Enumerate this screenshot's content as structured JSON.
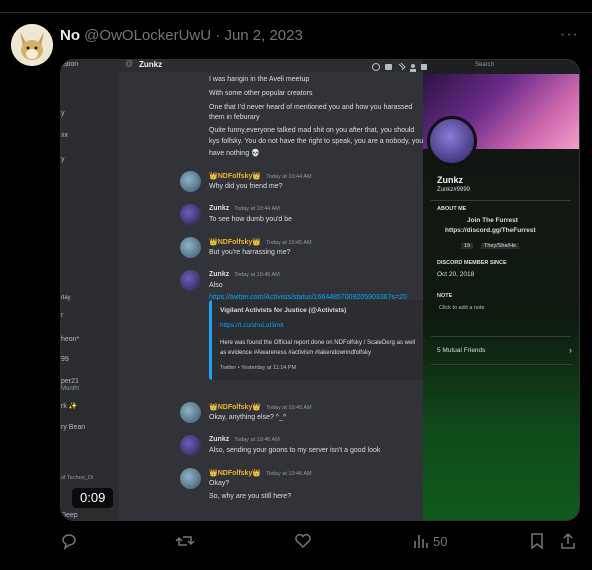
{
  "tweet": {
    "display_name": "No",
    "handle": "@OwOLockerUwU",
    "separator": "·",
    "date": "Jun 2, 2023",
    "more": "···",
    "views": "50"
  },
  "video": {
    "timer": "0:09"
  },
  "discord": {
    "channel": "Zunkz",
    "search_placeholder": "Search",
    "left_partial": [
      "ation",
      "y",
      "xx",
      "y",
      "day",
      "r",
      "heon*",
      "99",
      "per21",
      "Month!",
      "rk ✨",
      "ry Bean",
      "of Techno_Oi",
      "Deep"
    ],
    "messages": [
      {
        "type": "text",
        "text": "I was hangin in the Aveli meetup"
      },
      {
        "type": "text",
        "text": "With some other popular creators"
      },
      {
        "type": "text",
        "text": "One that I'd never heard of mentioned you and how you harassed"
      },
      {
        "type": "text",
        "text": "them in feburary"
      },
      {
        "type": "text",
        "text": "Quite funny,everyone talked mad shit on you after that, you should"
      },
      {
        "type": "text",
        "text": "kys folfsky. You do not have the right to speak, you are a nobody, you"
      },
      {
        "type": "text",
        "text": "have nothing 💀"
      }
    ],
    "posts": [
      {
        "user": "👑NDFolfsky👑",
        "time": "Today at 10:44 AM",
        "text": "Why did you friend me?",
        "color": "#f0b232"
      },
      {
        "user": "Zunkz",
        "time": "Today at 10:44 AM",
        "text": "To see how dumb you'd be",
        "color": "#dbdee1"
      },
      {
        "user": "👑NDFolfsky👑",
        "time": "Today at 10:45 AM",
        "text": "But you're harrassing me?",
        "color": "#f0b232"
      },
      {
        "user": "Zunkz",
        "time": "Today at 10:45 AM",
        "text": "Also",
        "color": "#dbdee1"
      },
      {
        "user": "👑NDFolfsky👑",
        "time": "Today at 10:45 AM",
        "text": "Okay, anything else? ^_^",
        "color": "#f0b232"
      },
      {
        "user": "Zunkz",
        "time": "Today at 10:46 AM",
        "text": "Also, sending your goons to my server isn't a good look",
        "color": "#dbdee1"
      },
      {
        "user": "👑NDFolfsky👑",
        "time": "Today at 10:46 AM",
        "text": "Okay?",
        "color": "#f0b232"
      }
    ],
    "last_line": "So, why are you still here?",
    "link": "https://twitter.com/Activists/status/1664485700920590336?s=20",
    "embed": {
      "title": "Vigilant Activists for Justice (@Activists)",
      "short": "https://t.co/shoLoI3mll",
      "body1": "Here was found the Official report done on NDFolfsky / ScaleDerg as well",
      "body2": "as evidence #Awareness #activism #takendownndfolfsky",
      "footer": "Twitter • Yesterday at 11:14 PM"
    },
    "profile": {
      "name": "Zunkz",
      "tag": "Zunkz#9999",
      "about_h": "ABOUT ME",
      "join": "Join The Furrest",
      "invite": "https://discord.gg/TheFurrest",
      "age": "19",
      "pronouns": "They/She/He",
      "since_h": "DISCORD MEMBER SINCE",
      "since": "Oct 20, 2018",
      "note_h": "NOTE",
      "note": "Click to add a note",
      "mutual": "5 Mutual Friends"
    }
  }
}
